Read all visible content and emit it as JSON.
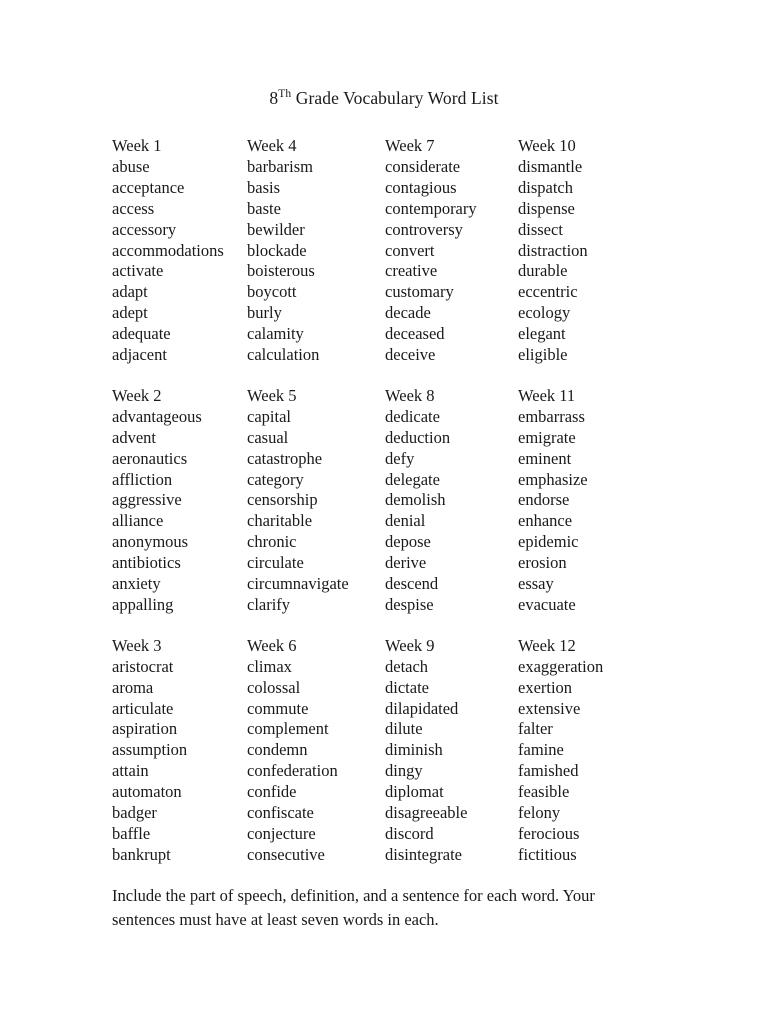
{
  "document": {
    "title_number": "8",
    "title_ordinal": "Th",
    "title_rest": " Grade Vocabulary Word List",
    "title_full": "8Th Grade Vocabulary Word List",
    "footer_note": "Include the part of speech, definition, and a sentence for each word.  Your sentences must have at least seven words in each.",
    "background_color": "#ffffff",
    "text_color": "#1a1a1a"
  },
  "blocks": [
    {
      "columns": [
        {
          "heading": "Week 1",
          "words": [
            "abuse",
            "acceptance",
            "access",
            "accessory",
            "accommodations",
            "activate",
            "adapt",
            "adept",
            "adequate",
            "adjacent"
          ]
        },
        {
          "heading": "Week 4",
          "words": [
            "barbarism",
            "basis",
            "baste",
            "bewilder",
            "blockade",
            "boisterous",
            "boycott",
            "burly",
            "calamity",
            "calculation"
          ]
        },
        {
          "heading": "Week 7",
          "words": [
            "considerate",
            "contagious",
            "contemporary",
            "controversy",
            "convert",
            "creative",
            "customary",
            "decade",
            "deceased",
            "deceive"
          ]
        },
        {
          "heading": "Week 10",
          "words": [
            "dismantle",
            "dispatch",
            "dispense",
            "dissect",
            "distraction",
            "durable",
            "eccentric",
            "ecology",
            "elegant",
            "eligible"
          ]
        }
      ]
    },
    {
      "columns": [
        {
          "heading": "Week 2",
          "words": [
            "advantageous",
            "advent",
            "aeronautics",
            "affliction",
            "aggressive",
            "alliance",
            "anonymous",
            "antibiotics",
            "anxiety",
            "appalling"
          ]
        },
        {
          "heading": "Week 5",
          "words": [
            "capital",
            "casual",
            "catastrophe",
            "category",
            "censorship",
            "charitable",
            "chronic",
            "circulate",
            "circumnavigate",
            "clarify"
          ]
        },
        {
          "heading": "Week 8",
          "words": [
            "dedicate",
            "deduction",
            "defy",
            "delegate",
            "demolish",
            "denial",
            "depose",
            "derive",
            "descend",
            "despise"
          ]
        },
        {
          "heading": "Week 11",
          "words": [
            "embarrass",
            "emigrate",
            "eminent",
            "emphasize",
            "endorse",
            "enhance",
            "epidemic",
            "erosion",
            "essay",
            "evacuate"
          ]
        }
      ]
    },
    {
      "columns": [
        {
          "heading": "Week 3",
          "words": [
            "aristocrat",
            "aroma",
            "articulate",
            "aspiration",
            "assumption",
            "attain",
            "automaton",
            "badger",
            "baffle",
            "bankrupt"
          ]
        },
        {
          "heading": "Week 6",
          "words": [
            "climax",
            "colossal",
            "commute",
            "complement",
            "condemn",
            "confederation",
            "confide",
            "confiscate",
            "conjecture",
            "consecutive"
          ]
        },
        {
          "heading": "Week 9",
          "words": [
            "detach",
            "dictate",
            "dilapidated",
            "dilute",
            "diminish",
            "dingy",
            "diplomat",
            "disagreeable",
            "discord",
            "disintegrate"
          ]
        },
        {
          "heading": "Week 12",
          "words": [
            "exaggeration",
            "exertion",
            "extensive",
            "falter",
            "famine",
            "famished",
            "feasible",
            "felony",
            "ferocious",
            "fictitious"
          ]
        }
      ]
    }
  ]
}
